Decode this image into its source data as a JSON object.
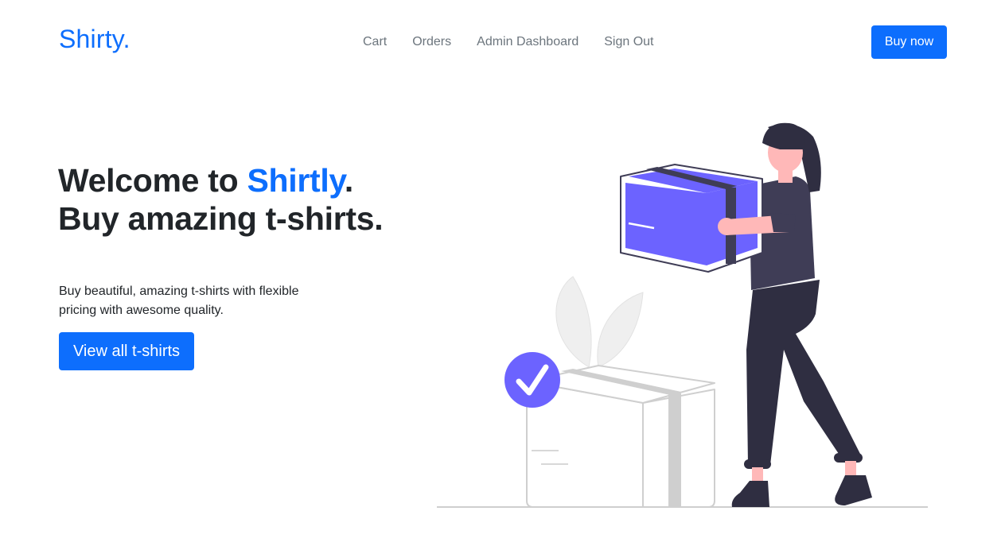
{
  "navbar": {
    "brand": "Shirty.",
    "links": [
      "Cart",
      "Orders",
      "Admin Dashboard",
      "Sign Out"
    ],
    "buy_button": "Buy now"
  },
  "hero": {
    "title_prefix": "Welcome to ",
    "title_accent": "Shirtly",
    "title_suffix": ".",
    "title_line2": "Buy amazing t-shirts.",
    "description": "Buy beautiful, amazing t-shirts with flexible pricing with awesome quality.",
    "cta_button": "View all t-shirts"
  },
  "colors": {
    "primary": "#0d6efd",
    "illustration_accent": "#6c63ff",
    "illustration_dark": "#2f2e41",
    "skin": "#ffb8b8"
  }
}
